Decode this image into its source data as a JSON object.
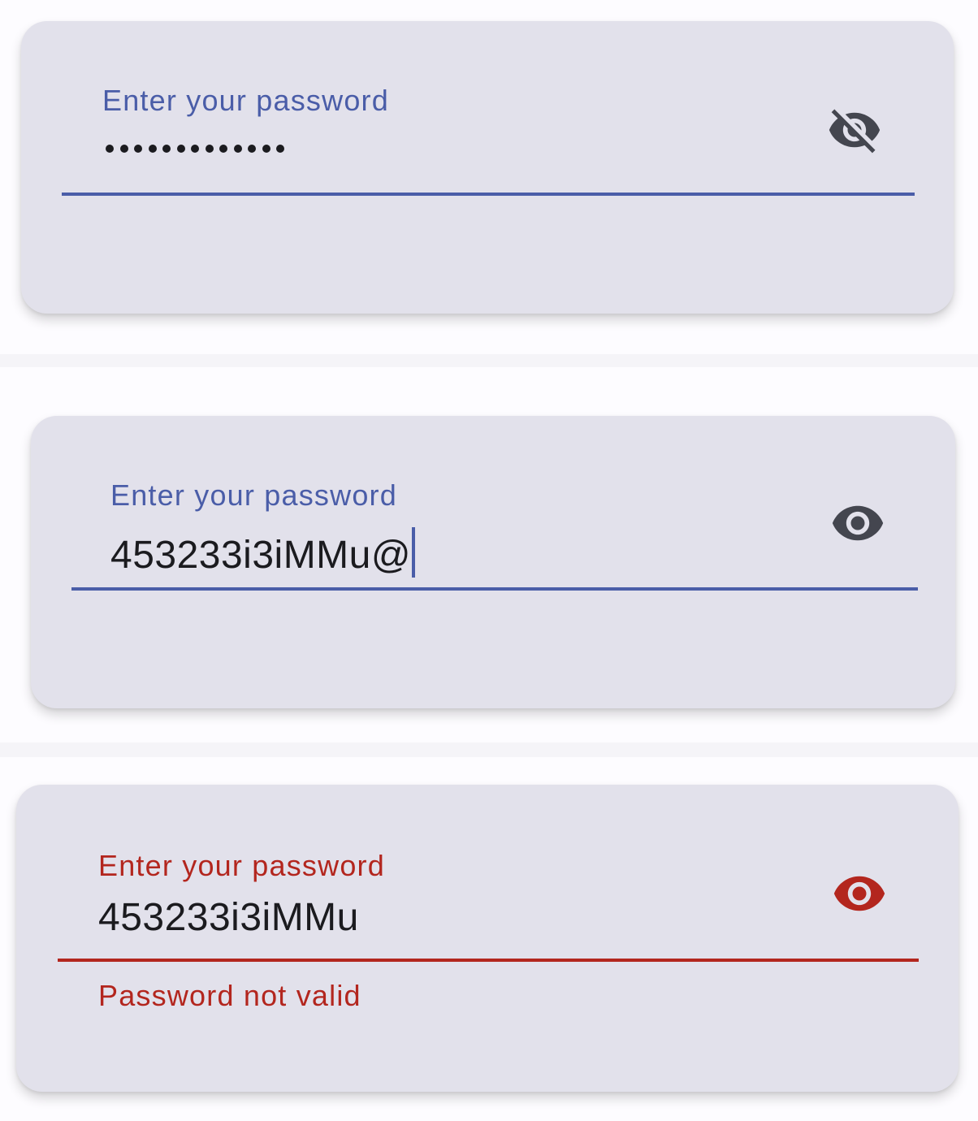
{
  "colors": {
    "background": "#fdfcff",
    "card": "#e2e1eb",
    "primary": "#4a5da8",
    "error": "#b3261e",
    "on_surface": "#1b1b1f",
    "icon": "#44464f"
  },
  "fields": [
    {
      "state": "hidden",
      "label": "Enter your password",
      "masked_length": 13,
      "toggle_icon": "visibility-off-icon"
    },
    {
      "state": "visible-focused",
      "label": "Enter your password",
      "value": "453233i3iMMu@",
      "toggle_icon": "visibility-icon"
    },
    {
      "state": "error",
      "label": "Enter your password",
      "value": "453233i3iMMu",
      "toggle_icon": "visibility-icon",
      "helper_text": "Password not valid"
    }
  ]
}
